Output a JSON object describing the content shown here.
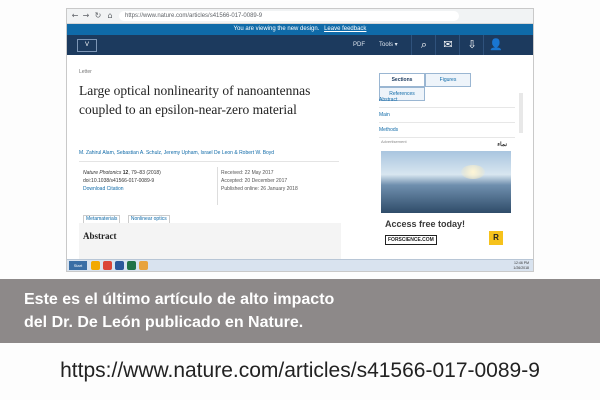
{
  "browser": {
    "url": "https://www.nature.com/articles/s41566-017-0089-9",
    "back_glyph": "←",
    "forward_glyph": "→",
    "reload_glyph": "↻",
    "home_glyph": "⌂"
  },
  "banner": {
    "text": "You are viewing the new design.",
    "feedback": "Leave feedback"
  },
  "navbar": {
    "menu_label": "V",
    "pdf_label": "PDF",
    "tools_label": "Tools ▾",
    "icons": [
      "search-icon",
      "email-icon",
      "download-icon",
      "user-icon"
    ],
    "icon_glyphs": [
      "⌕",
      "✉",
      "⇩",
      "👤"
    ]
  },
  "article": {
    "kicker": "Letter",
    "title": "Large optical nonlinearity of nanoantennas coupled to an epsilon-near-zero material",
    "authors": "M. Zahirul Alam, Sebastian A. Schulz, Jeremy Upham, Israel De Leon & Robert W. Boyd",
    "journal": "Nature Photonics",
    "volume": "12",
    "pages": ", 79–83 (2018)",
    "doi": "doi:10.1038/s41566-017-0089-9",
    "citation_link": "Download Citation",
    "received": "Received: 22 May 2017",
    "accepted": "Accepted: 20 December 2017",
    "published": "Published online: 26 January 2018",
    "tags": [
      "Metamaterials",
      "Nonlinear optics"
    ],
    "abstract_heading": "Abstract"
  },
  "sidebar": {
    "tabs": [
      "Sections",
      "Figures",
      "References"
    ],
    "active_tab": 0,
    "sections": [
      "Abstract",
      "Main",
      "Methods"
    ]
  },
  "ad": {
    "label": "Advertisement",
    "brand": "نماء",
    "headline": "Access free today!",
    "site": "FORSCIENCE.COM",
    "badge": "R"
  },
  "taskbar": {
    "start_label": "Start",
    "time": "12:46 PM",
    "date": "1/26/2018"
  },
  "caption": {
    "line1": "Este es el último artículo de alto impacto",
    "line2": "del Dr. De León publicado en Nature."
  },
  "footer": {
    "url": "https://www.nature.com/articles/s41566-017-0089-9"
  },
  "colors": {
    "banner": "#0f6aa8",
    "navbar": "#1c3a5e",
    "caption_band": "#8d8989",
    "link": "#0f6aa8"
  }
}
